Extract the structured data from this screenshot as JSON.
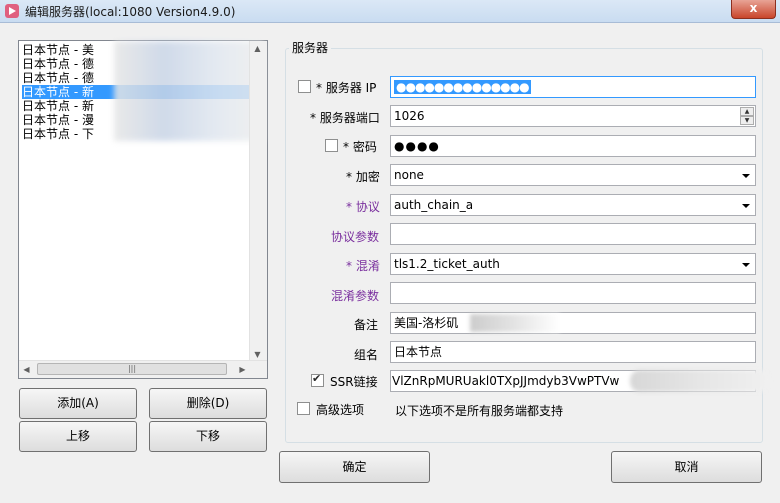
{
  "window": {
    "title": "编辑服务器(local:1080 Version4.9.0)",
    "close_label": "x"
  },
  "server_list": {
    "items": [
      "日本节点 - 美",
      "日本节点 - 德",
      "日本节点 - 德",
      "日本节点 - 新",
      "日本节点 - 新",
      "日本节点 - 漫",
      "日本节点 - 下"
    ],
    "selected_index": 3,
    "hscroll_grip": "|||"
  },
  "list_buttons": {
    "add": "添加(A)",
    "delete": "删除(D)",
    "move_up": "上移",
    "move_down": "下移"
  },
  "server_group": {
    "title": "服务器",
    "server_ip": {
      "label": "* 服务器 IP",
      "value": "●●●●●●●●●●●●●●",
      "show_checked": false
    },
    "server_port": {
      "label": "* 服务器端口",
      "value": "1026"
    },
    "password": {
      "label": "* 密码",
      "value": "●●●●",
      "show_checked": false
    },
    "encryption": {
      "label": "* 加密",
      "value": "none"
    },
    "protocol": {
      "label": "* 协议",
      "value": "auth_chain_a"
    },
    "protocol_param": {
      "label": "协议参数",
      "value": ""
    },
    "obfs": {
      "label": "* 混淆",
      "value": "tls1.2_ticket_auth"
    },
    "obfs_param": {
      "label": "混淆参数",
      "value": ""
    },
    "remarks": {
      "label": "备注",
      "value": "美国-洛杉矶"
    },
    "group": {
      "label": "组名",
      "value": "日本节点"
    },
    "ssr_link": {
      "label": "SSR链接",
      "value": "VlZnRpMURUakl0TXpJJmdyb3VwPTVw",
      "checked": true
    },
    "advanced": {
      "label": "高级选项",
      "note": "以下选项不是所有服务端都支持",
      "checked": false
    }
  },
  "dialog_buttons": {
    "ok": "确定",
    "cancel": "取消"
  },
  "colors": {
    "selection": "#3399ff",
    "purple_label": "#7a2f9e",
    "title_bar": "#c9dcf1"
  }
}
